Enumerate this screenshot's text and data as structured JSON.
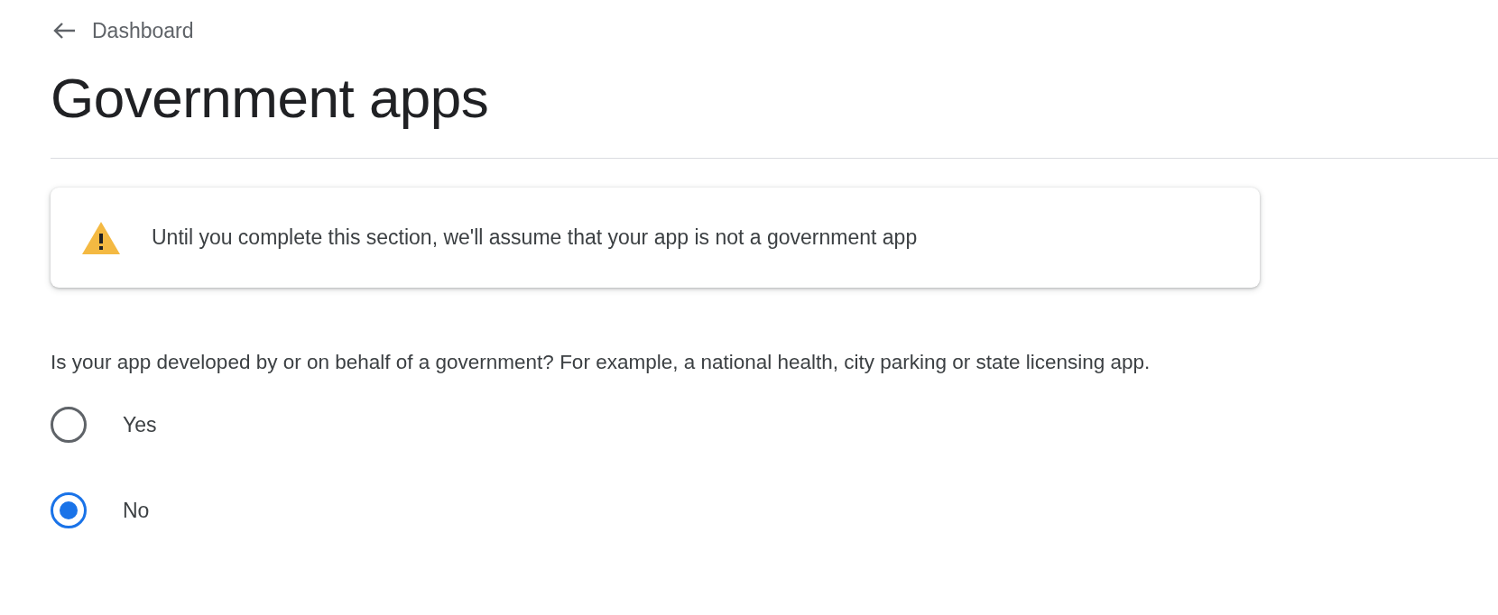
{
  "back_link": {
    "label": "Dashboard"
  },
  "title": "Government apps",
  "notice": {
    "kind": "warning",
    "text": "Until you complete this section, we'll assume that your app is not a government app"
  },
  "question": "Is your app developed by or on behalf of a government? For example, a national health, city parking or state licensing app.",
  "options": [
    {
      "label": "Yes",
      "selected": false
    },
    {
      "label": "No",
      "selected": true
    }
  ]
}
